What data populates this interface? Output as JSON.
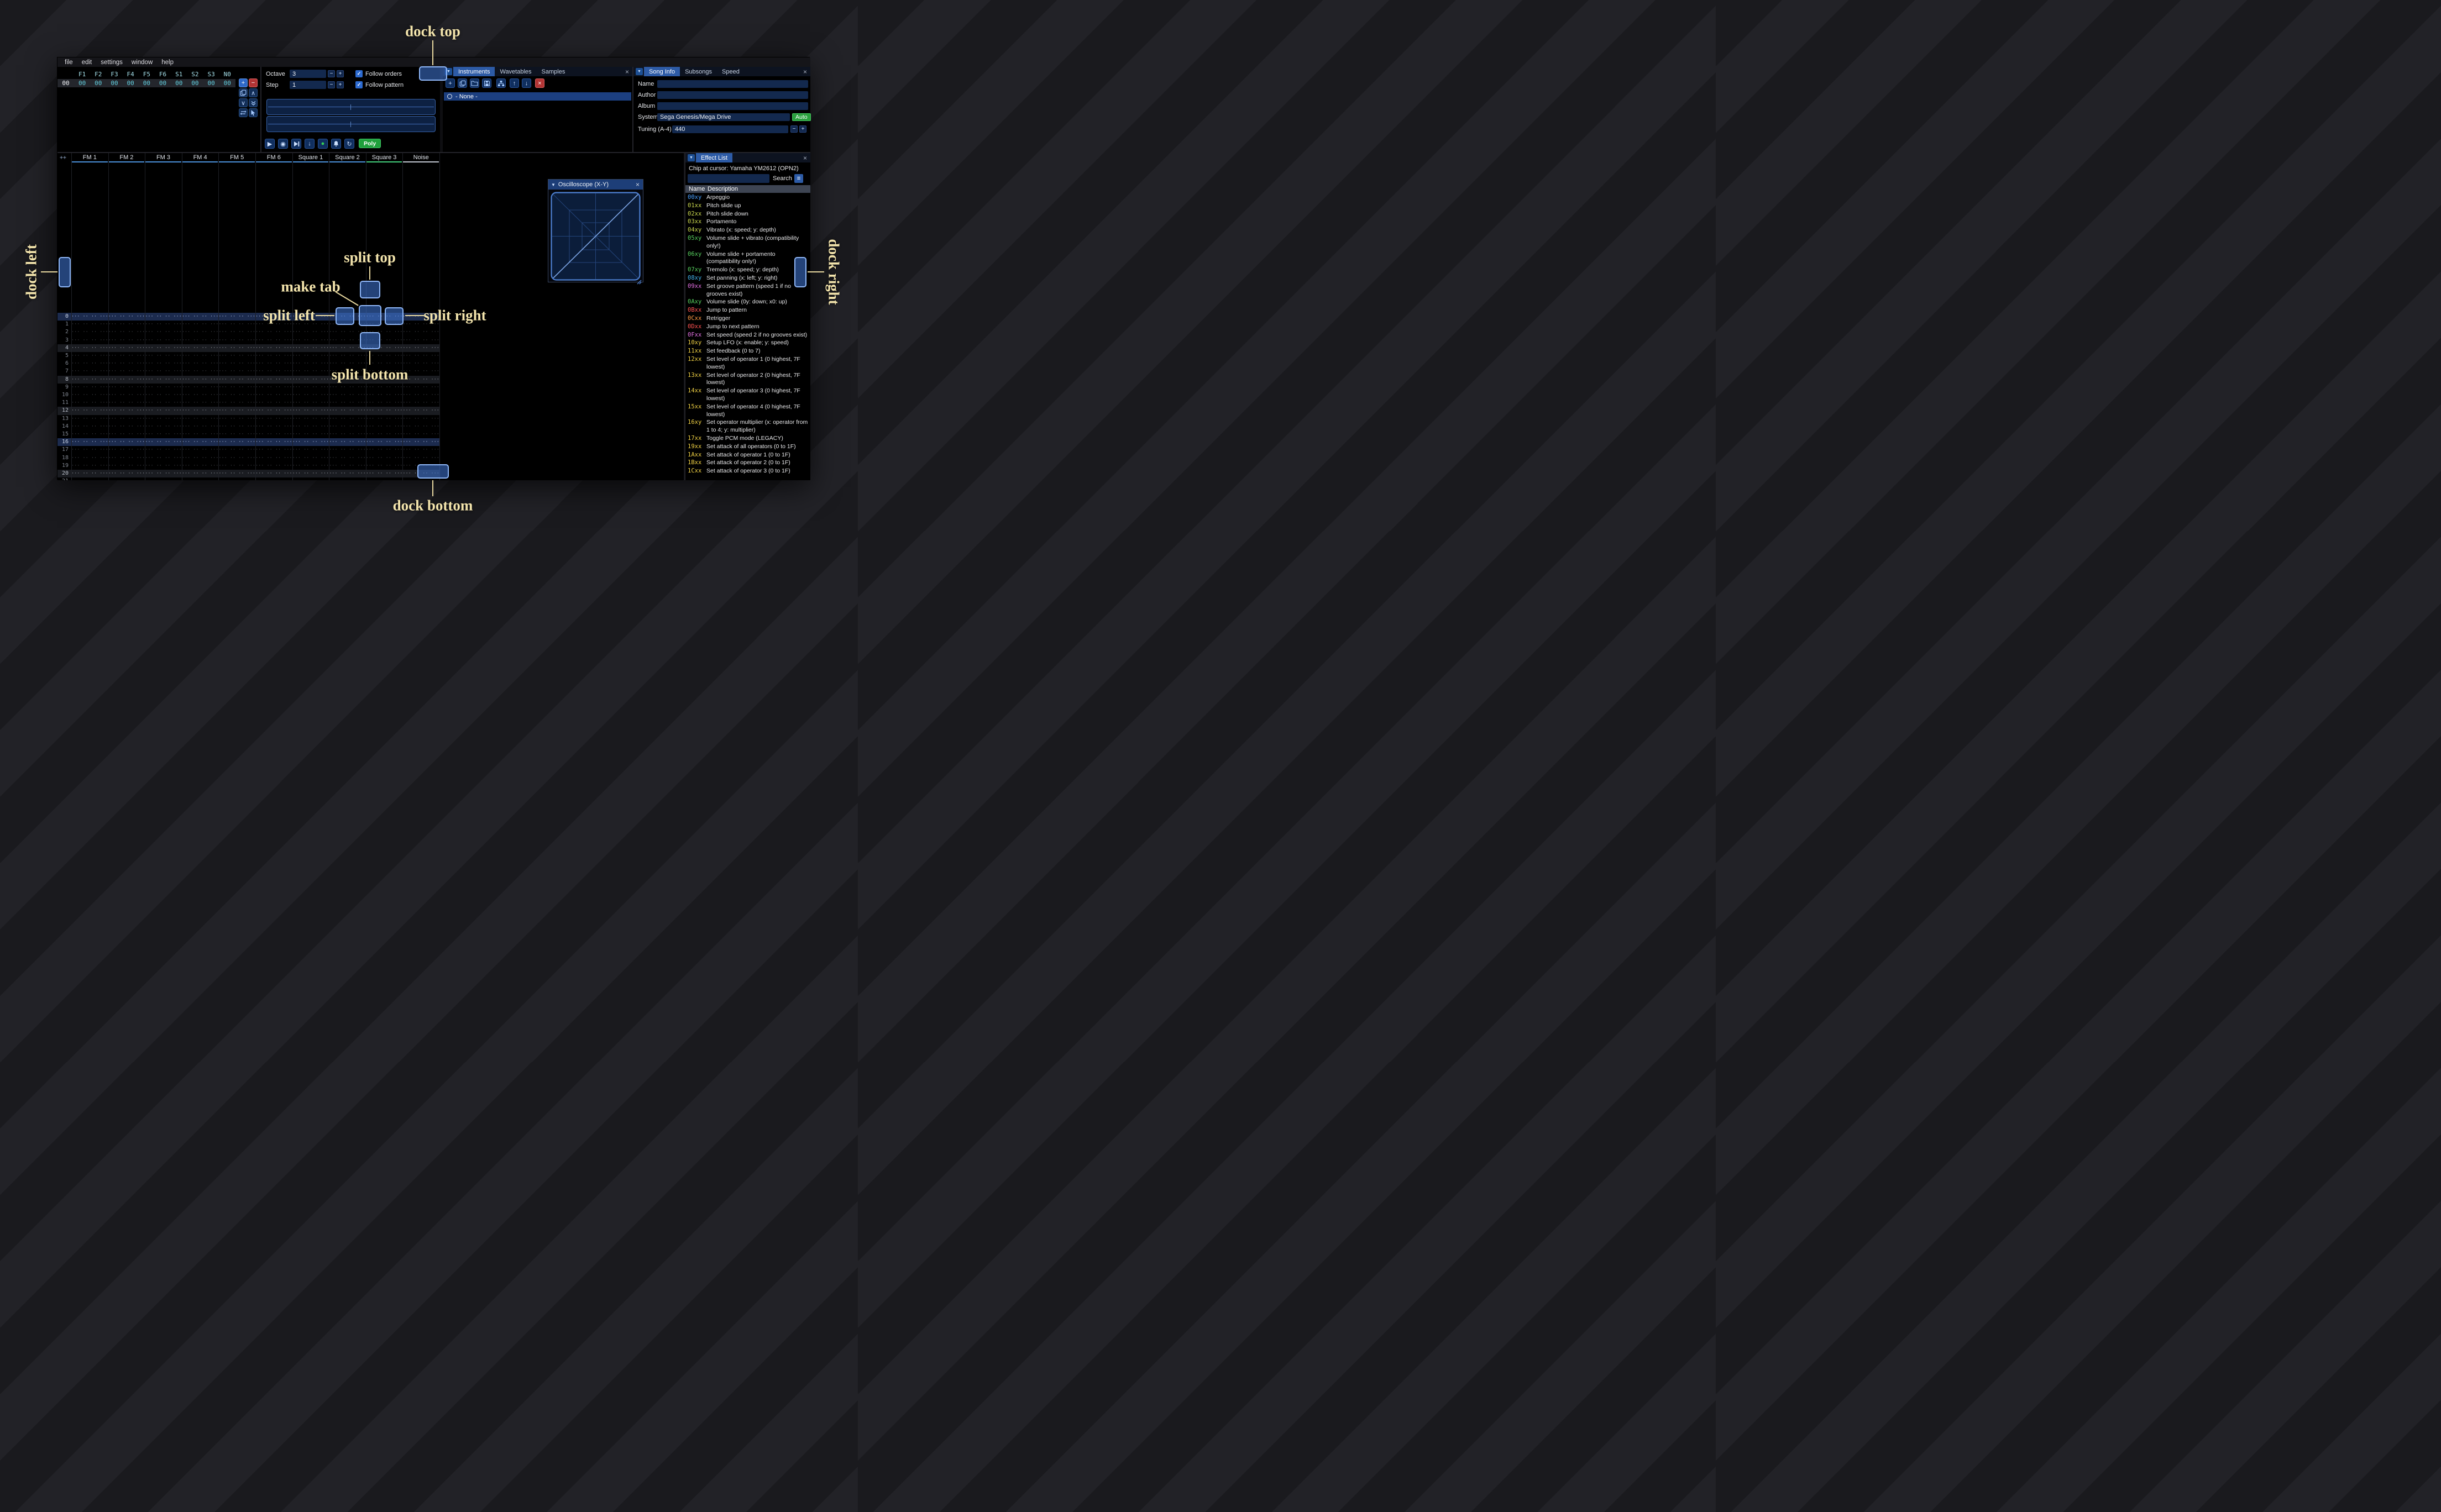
{
  "window": {
    "menu": [
      "file",
      "edit",
      "settings",
      "window",
      "help"
    ]
  },
  "icons": {
    "plus": "+",
    "minus": "−",
    "check": "✓",
    "close": "×",
    "dock_menu": "▼",
    "collapse_arrow": "▼",
    "hamburger": "≡",
    "play": "▶",
    "play_from_cursor": "◉",
    "step_arrow": "↓",
    "record": "●",
    "repeat": "↻",
    "move_up": "↑",
    "move_down": "↓",
    "chevron_up": "∧",
    "chevron_down": "∨"
  },
  "orders": {
    "headers": [
      "F1",
      "F2",
      "F3",
      "F4",
      "F5",
      "F6",
      "S1",
      "S2",
      "S3",
      "N0"
    ],
    "row_index": "00",
    "row_values": [
      "00",
      "00",
      "00",
      "00",
      "00",
      "00",
      "00",
      "00",
      "00",
      "00"
    ]
  },
  "controls": {
    "octave_label": "Octave",
    "octave_value": "3",
    "step_label": "Step",
    "step_value": "1",
    "follow_orders_label": "Follow orders",
    "follow_pattern_label": "Follow pattern",
    "poly_label": "Poly"
  },
  "instruments": {
    "tabs": [
      "Instruments",
      "Wavetables",
      "Samples"
    ],
    "selected_index": 0,
    "none_item": "- None -"
  },
  "song": {
    "tabs": [
      "Song Info",
      "Subsongs",
      "Speed"
    ],
    "selected_index": 0,
    "name_label": "Name",
    "name_value": "",
    "author_label": "Author",
    "author_value": "",
    "album_label": "Album",
    "album_value": "",
    "system_label": "System",
    "system_value": "Sega Genesis/Mega Drive",
    "auto_label": "Auto",
    "tuning_label": "Tuning (A-4)",
    "tuning_value": "440"
  },
  "pattern": {
    "corner_label": "++",
    "channels": [
      {
        "name": "FM 1",
        "color": "#4a8fd8"
      },
      {
        "name": "FM 2",
        "color": "#4a8fd8"
      },
      {
        "name": "FM 3",
        "color": "#4a8fd8"
      },
      {
        "name": "FM 4",
        "color": "#4a8fd8"
      },
      {
        "name": "FM 5",
        "color": "#4a8fd8"
      },
      {
        "name": "FM 6",
        "color": "#4a8fd8"
      },
      {
        "name": "Square 1",
        "color": "#4a8fd8"
      },
      {
        "name": "Square 2",
        "color": "#4a8fd8"
      },
      {
        "name": "Square 3",
        "color": "#43cf7c"
      },
      {
        "name": "Noise",
        "color": "#c2c8d2"
      }
    ],
    "rows": 22,
    "empty_cell": "··· ·· ·· ···"
  },
  "scope": {
    "title": "Oscilloscope (X-Y)"
  },
  "effects": {
    "tab": "Effect List",
    "chip_line": "Chip at cursor: Yamaha YM2612 (OPN2)",
    "search_label": "Search",
    "name_col": "Name",
    "desc_col": "Description",
    "list": [
      {
        "code": "00xy",
        "desc": "Arpeggio",
        "color": "#4aa0ff"
      },
      {
        "code": "01xx",
        "desc": "Pitch slide up",
        "color": "#c8d64e"
      },
      {
        "code": "02xx",
        "desc": "Pitch slide down",
        "color": "#c8d64e"
      },
      {
        "code": "03xx",
        "desc": "Portamento",
        "color": "#c8d64e"
      },
      {
        "code": "04xy",
        "desc": "Vibrato (x: speed; y: depth)",
        "color": "#c8d64e"
      },
      {
        "code": "05xy",
        "desc": "Volume slide + vibrato (compatibility only!)",
        "color": "#57d05f"
      },
      {
        "code": "06xy",
        "desc": "Volume slide + portamento (compatibility only!)",
        "color": "#57d05f"
      },
      {
        "code": "07xy",
        "desc": "Tremolo (x: speed; y: depth)",
        "color": "#57d05f"
      },
      {
        "code": "08xy",
        "desc": "Set panning (x: left; y: right)",
        "color": "#42b0e8"
      },
      {
        "code": "09xx",
        "desc": "Set groove pattern (speed 1 if no grooves exist)",
        "color": "#e270e2"
      },
      {
        "code": "0Axy",
        "desc": "Volume slide (0y: down; x0: up)",
        "color": "#57d05f"
      },
      {
        "code": "0Bxx",
        "desc": "Jump to pattern",
        "color": "#ff5252"
      },
      {
        "code": "0Cxx",
        "desc": "Retrigger",
        "color": "#ff9b44"
      },
      {
        "code": "0Dxx",
        "desc": "Jump to next pattern",
        "color": "#ff5252"
      },
      {
        "code": "0Fxx",
        "desc": "Set speed (speed 2 if no grooves exist)",
        "color": "#e270e2"
      },
      {
        "code": "10xy",
        "desc": "Setup LFO (x: enable; y: speed)",
        "color": "#efd044"
      },
      {
        "code": "11xx",
        "desc": "Set feedback (0 to 7)",
        "color": "#efd044"
      },
      {
        "code": "12xx",
        "desc": "Set level of operator 1 (0 highest, 7F lowest)",
        "color": "#efd044"
      },
      {
        "code": "13xx",
        "desc": "Set level of operator 2 (0 highest, 7F lowest)",
        "color": "#efd044"
      },
      {
        "code": "14xx",
        "desc": "Set level of operator 3 (0 highest, 7F lowest)",
        "color": "#efd044"
      },
      {
        "code": "15xx",
        "desc": "Set level of operator 4 (0 highest, 7F lowest)",
        "color": "#efd044"
      },
      {
        "code": "16xy",
        "desc": "Set operator multiplier (x: operator from 1 to 4; y: multiplier)",
        "color": "#efd044"
      },
      {
        "code": "17xx",
        "desc": "Toggle PCM mode (LEGACY)",
        "color": "#efd044"
      },
      {
        "code": "19xx",
        "desc": "Set attack of all operators (0 to 1F)",
        "color": "#efd044"
      },
      {
        "code": "1Axx",
        "desc": "Set attack of operator 1 (0 to 1F)",
        "color": "#efd044"
      },
      {
        "code": "1Bxx",
        "desc": "Set attack of operator 2 (0 to 1F)",
        "color": "#efd044"
      },
      {
        "code": "1Cxx",
        "desc": "Set attack of operator 3 (0 to 1F)",
        "color": "#efd044"
      }
    ]
  },
  "overlay": {
    "dock_top": "dock top",
    "dock_left": "dock left",
    "dock_right": "dock right",
    "dock_bottom": "dock bottom",
    "split_top": "split top",
    "split_bottom": "split bottom",
    "split_left": "split left",
    "split_right": "split right",
    "make_tab": "make tab"
  }
}
